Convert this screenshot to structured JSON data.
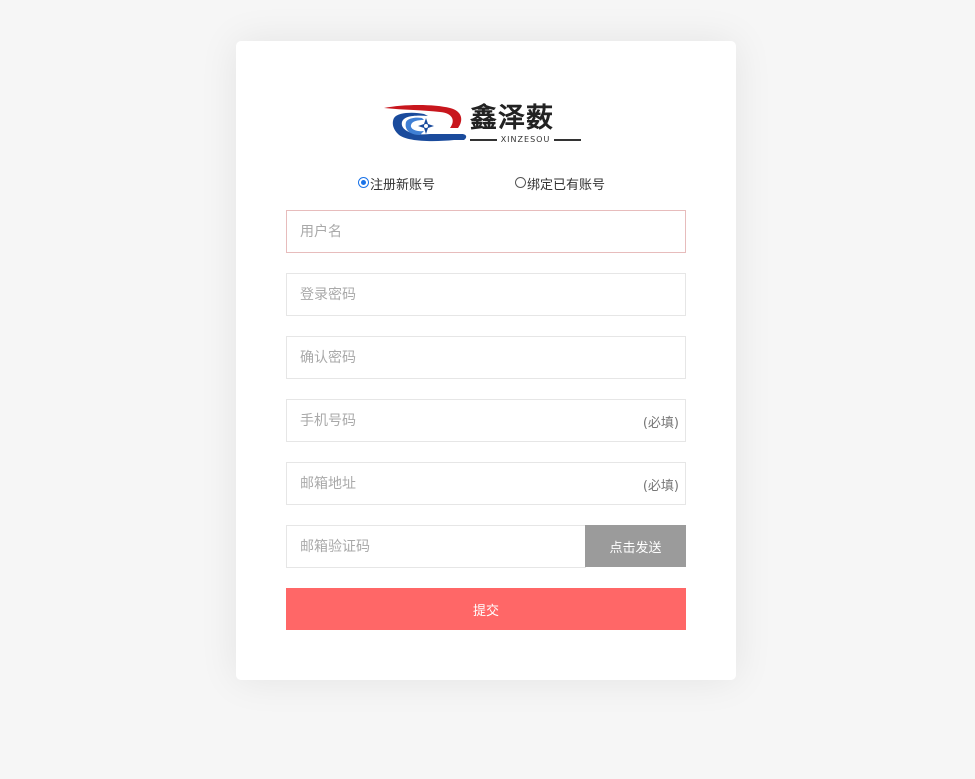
{
  "brand": {
    "name_cn": "鑫泽薮",
    "name_en": "XINZESOU",
    "logo_icon": "brand-logo-icon",
    "colors": {
      "red": "#c8161d",
      "blue": "#1a4b9c"
    }
  },
  "mode": {
    "selected": "register",
    "options": [
      {
        "id": "register",
        "label": "注册新账号"
      },
      {
        "id": "bind",
        "label": "绑定已有账号"
      }
    ]
  },
  "form": {
    "username": {
      "placeholder": "用户名",
      "value": ""
    },
    "password": {
      "placeholder": "登录密码",
      "value": ""
    },
    "confirm_password": {
      "placeholder": "确认密码",
      "value": ""
    },
    "phone": {
      "placeholder": "手机号码",
      "value": "",
      "required_label": "(必填)"
    },
    "email": {
      "placeholder": "邮箱地址",
      "value": "",
      "required_label": "(必填)"
    },
    "email_code": {
      "placeholder": "邮箱验证码",
      "value": ""
    },
    "send_code_label": "点击发送",
    "submit_label": "提交"
  },
  "colors": {
    "page_bg": "#f6f6f6",
    "submit_bg": "#ff6767",
    "send_bg": "#9b9b9b",
    "active_border": "#e7bcbc",
    "radio_accent": "#1a73e8"
  }
}
